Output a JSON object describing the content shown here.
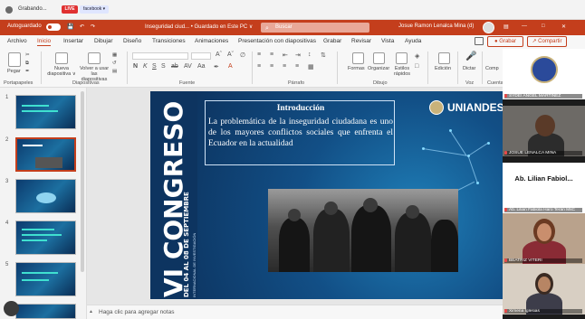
{
  "browser": {
    "tab_title": "Grabando...",
    "live_badge": "LIVE",
    "facebook_tab": "facebook ▾"
  },
  "titlebar": {
    "autosave": "Autoguardado",
    "document_title": "Inseguridad ciud... • Guardado en Este PC ∨",
    "search_placeholder": "Buscar",
    "user_name": "Josue Ramon Lenalca Mina (d)",
    "colors": {
      "accent": "#c43e1c"
    }
  },
  "ribbon_tabs": [
    "Archivo",
    "Inicio",
    "Insertar",
    "Dibujar",
    "Diseño",
    "Transiciones",
    "Animaciones",
    "Presentación con diapositivas",
    "Grabar",
    "Revisar",
    "Vista",
    "Ayuda"
  ],
  "ribbon_active": "Inicio",
  "buttons": {
    "grabar": "● Grabar",
    "compartir": "↗ Compartir"
  },
  "ribbon": {
    "paste": "Pegar",
    "new_slide": "Nueva diapositiva ∨",
    "reuse": "Volver a usar las diapositivas",
    "group_portapapeles": "Portapapeles",
    "group_diapositivas": "Diapositivas",
    "group_fuente": "Fuente",
    "group_parrafo": "Párrafo",
    "group_dibujo": "Dibujo",
    "group_voz": "Voz",
    "group_cuenta": "Cuenta",
    "formas": "Formas",
    "organizar": "Organizar",
    "estilos": "Estilos rápidos",
    "edicion": "Edición",
    "dictar": "Dictar",
    "comp": "Comp"
  },
  "slides": [
    {
      "number": "1"
    },
    {
      "number": "2"
    },
    {
      "number": "3"
    },
    {
      "number": "4"
    },
    {
      "number": "5"
    }
  ],
  "slide": {
    "title": "Introducción",
    "body": "La problemática de la inseguridad ciudadana es uno de los mayores conflictos sociales que enfrenta el Ecuador en la actualidad",
    "brand": "UNIANDES",
    "congreso": "VI CONGRESO",
    "congreso_dates": "DEL 04 AL 08 DE SEPTIEMBRE",
    "congreso_tag": "INTERNACIONAL DE INVESTIGACIÓN"
  },
  "notes": {
    "placeholder": "Haga clic para agregar notas"
  },
  "participants": [
    {
      "name": "SYDEI ANGEL MARTINEZ"
    },
    {
      "name": "JOSUE LENALCA MINA"
    },
    {
      "name": "Ab. Lilian Fabiola Haro Terán MsC",
      "display": "Ab. Lilian Fabiol..."
    },
    {
      "name": "BEATRIZ VITERI"
    },
    {
      "name": "Ximena Iglesias"
    }
  ]
}
